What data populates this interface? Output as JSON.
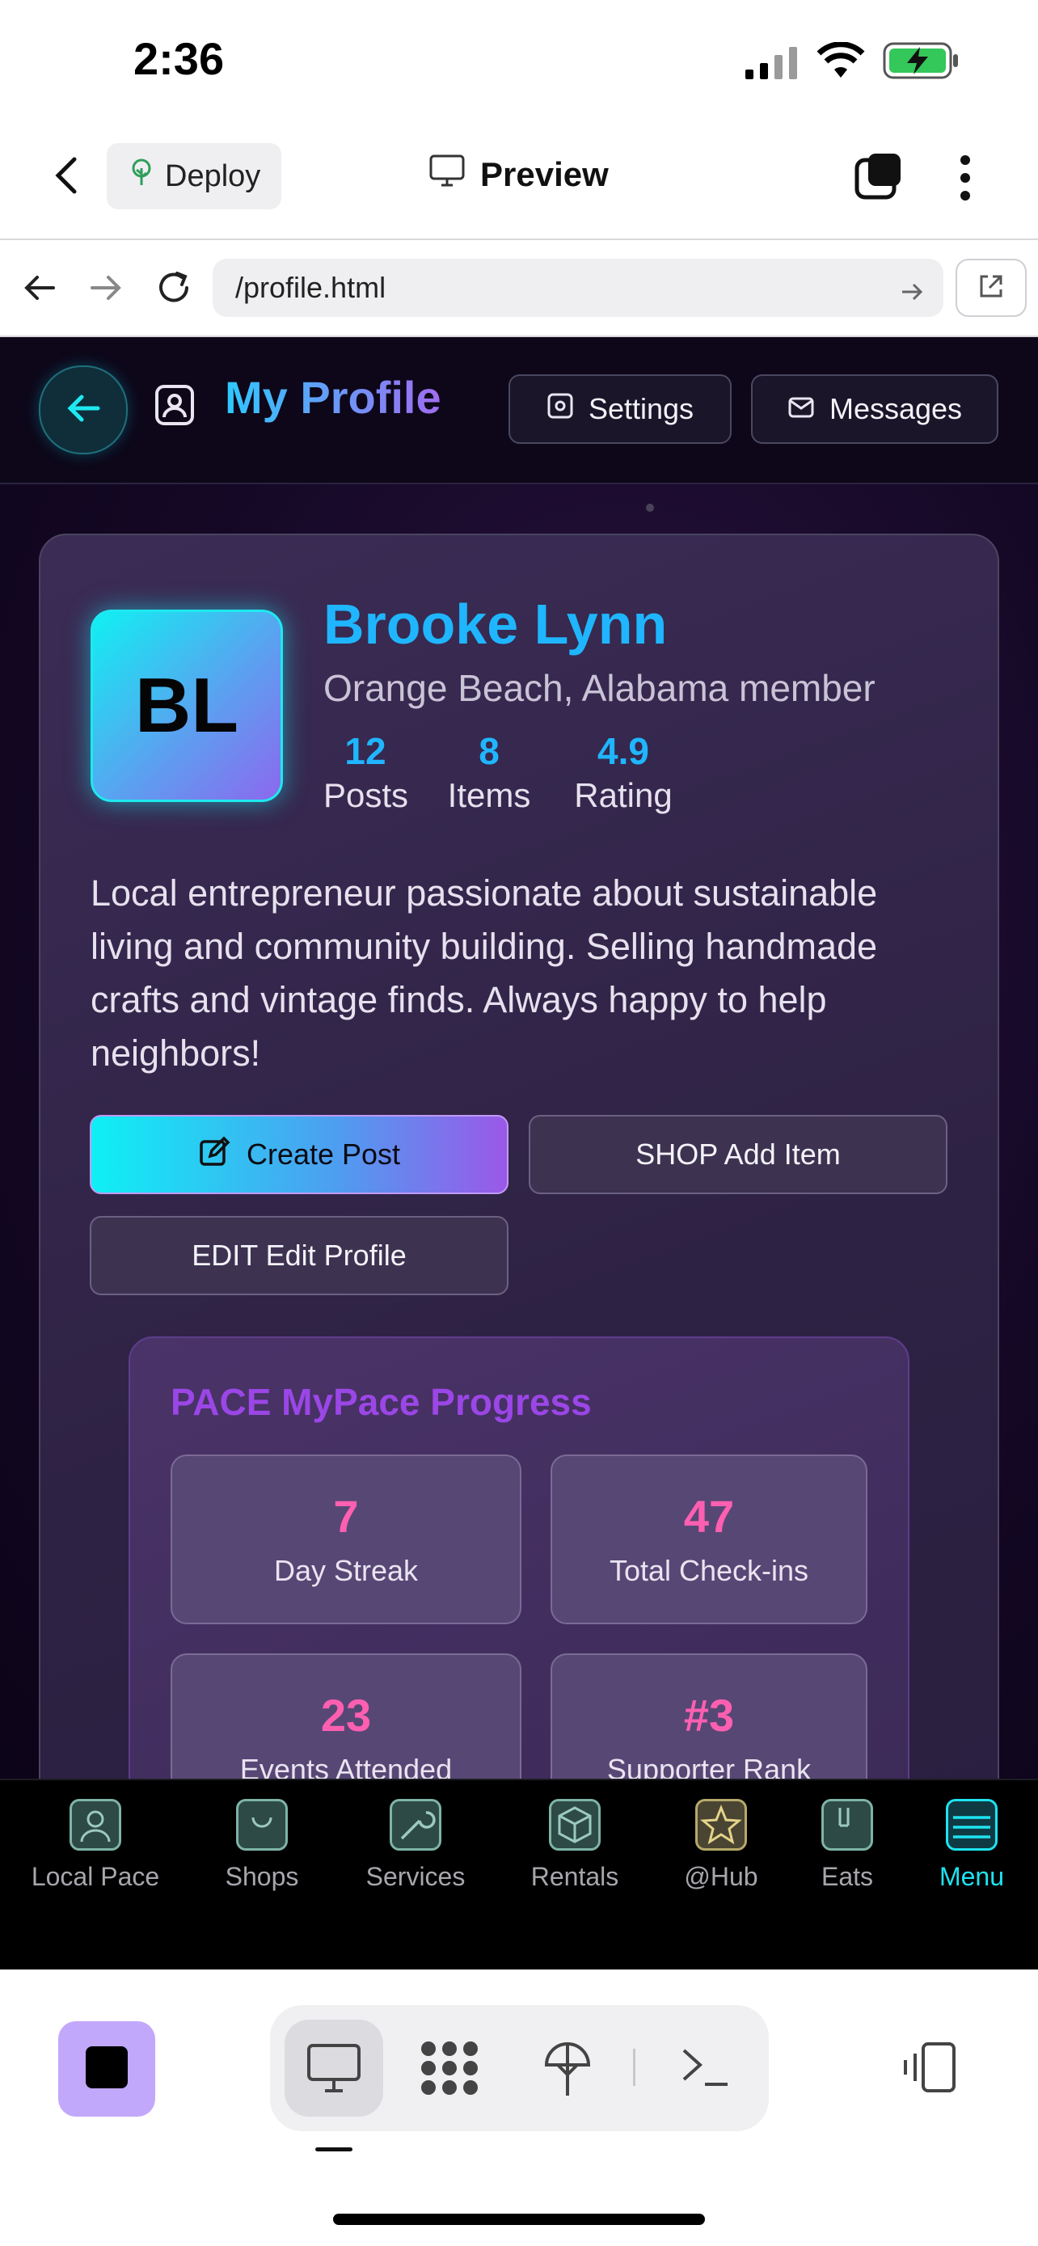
{
  "status_bar": {
    "time": "2:36"
  },
  "app_bar": {
    "deploy_label": "Deploy",
    "preview_label": "Preview"
  },
  "url_bar": {
    "url": "/profile.html"
  },
  "page": {
    "title": "My Profile",
    "settings_label": "Settings",
    "messages_label": "Messages"
  },
  "profile": {
    "initials": "BL",
    "name": "Brooke Lynn",
    "location": "Orange Beach, Alabama member",
    "stats": [
      {
        "value": "12",
        "label": "Posts"
      },
      {
        "value": "8",
        "label": "Items"
      },
      {
        "value": "4.9",
        "label": "Rating"
      }
    ],
    "bio": "Local entrepreneur passionate about sustainable living and community building. Selling handmade crafts and vintage finds. Always happy to help neighbors!",
    "actions": {
      "create_post": "Create Post",
      "add_item": "SHOP Add Item",
      "edit_profile": "EDIT Edit Profile"
    }
  },
  "pace": {
    "title": "PACE MyPace Progress",
    "tiles": [
      {
        "value": "7",
        "label": "Day Streak"
      },
      {
        "value": "47",
        "label": "Total Check-ins"
      },
      {
        "value": "23",
        "label": "Events Attended"
      },
      {
        "value": "#3",
        "label": "Supporter Rank"
      }
    ]
  },
  "bottom_nav": {
    "items": [
      {
        "label": "Local Pace",
        "icon": "person-icon"
      },
      {
        "label": "Shops",
        "icon": "bag-icon"
      },
      {
        "label": "Services",
        "icon": "wrench-icon"
      },
      {
        "label": "Rentals",
        "icon": "box-icon"
      },
      {
        "label": "@Hub",
        "icon": "star-icon"
      },
      {
        "label": "Eats",
        "icon": "food-icon"
      },
      {
        "label": "Menu",
        "icon": "menu-icon"
      }
    ],
    "active": "Menu"
  },
  "colors": {
    "accent_cyan": "#1ee3f0",
    "name_blue": "#1fb6ff",
    "pace_purple": "#9b46e6",
    "stat_pink": "#ff5fb0"
  }
}
